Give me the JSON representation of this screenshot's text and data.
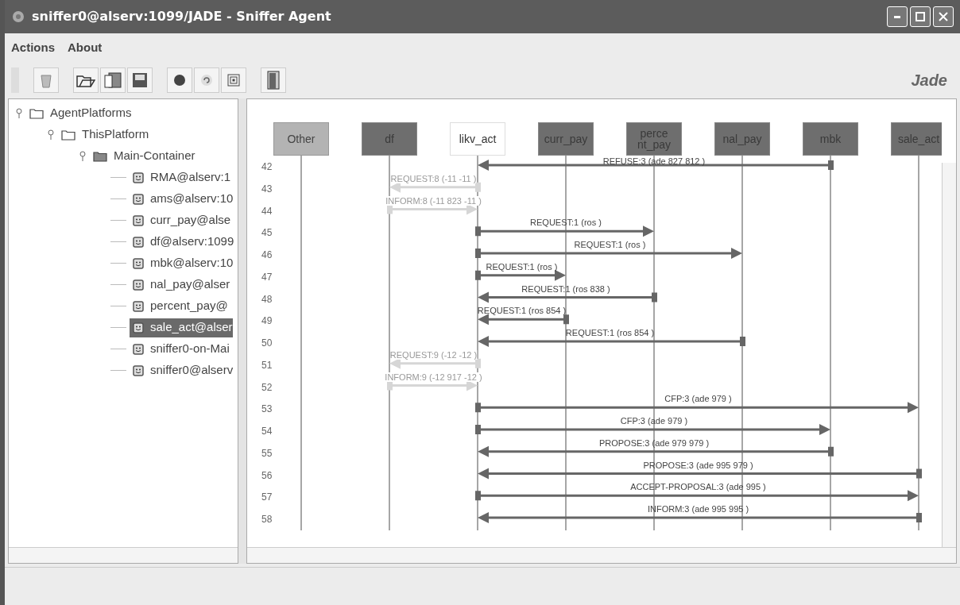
{
  "window": {
    "title": "sniffer0@alserv:1099/JADE - Sniffer Agent"
  },
  "menu": [
    "Actions",
    "About"
  ],
  "logo": "Jade",
  "tree": [
    {
      "label": "AgentPlatforms",
      "kind": "folder",
      "expanded": true,
      "children": [
        {
          "label": "ThisPlatform",
          "kind": "folder",
          "expanded": true,
          "children": [
            {
              "label": "Main-Container",
              "kind": "container",
              "expanded": true,
              "children": [
                {
                  "label": "RMA@alserv:1",
                  "kind": "agent",
                  "selected": false
                },
                {
                  "label": "ams@alserv:10",
                  "kind": "agent",
                  "selected": false
                },
                {
                  "label": "curr_pay@alse",
                  "kind": "agent",
                  "selected": false
                },
                {
                  "label": "df@alserv:1099",
                  "kind": "agent",
                  "selected": false
                },
                {
                  "label": "mbk@alserv:10",
                  "kind": "agent",
                  "selected": false
                },
                {
                  "label": "nal_pay@alser",
                  "kind": "agent",
                  "selected": false
                },
                {
                  "label": "percent_pay@",
                  "kind": "agent",
                  "selected": false
                },
                {
                  "label": "sale_act@alser",
                  "kind": "agent",
                  "selected": true
                },
                {
                  "label": "sniffer0-on-Mai",
                  "kind": "agent",
                  "selected": false
                },
                {
                  "label": "sniffer0@alserv",
                  "kind": "agent",
                  "selected": false
                }
              ]
            }
          ]
        }
      ]
    }
  ],
  "agents": [
    {
      "label": "Other",
      "kind": "other"
    },
    {
      "label": "df",
      "kind": "sniffed"
    },
    {
      "label": "likv_act",
      "kind": "plain"
    },
    {
      "label": "curr_pay",
      "kind": "sniffed"
    },
    {
      "label": "perce nt_pay",
      "kind": "sniffed"
    },
    {
      "label": "nal_pay",
      "kind": "sniffed"
    },
    {
      "label": "mbk",
      "kind": "sniffed"
    },
    {
      "label": "sale_act",
      "kind": "sniffed"
    }
  ],
  "messages": [
    {
      "number": "42",
      "lanes": [
        {
          "kind": "idle"
        },
        {
          "kind": "idle"
        },
        {
          "kind": "target"
        },
        {
          "kind": "idle"
        },
        {
          "kind": "idle"
        },
        {
          "kind": "idle"
        },
        {
          "kind": "source"
        },
        {
          "kind": "idle"
        }
      ],
      "label": "REFUSE:3 (ade 827 812 )",
      "faded": false
    },
    {
      "number": "43",
      "lanes": [
        {
          "kind": "idle"
        },
        {
          "kind": "target"
        },
        {
          "kind": "source"
        },
        {
          "kind": "idle"
        },
        {
          "kind": "idle"
        },
        {
          "kind": "idle"
        },
        {
          "kind": "idle"
        },
        {
          "kind": "idle"
        }
      ],
      "label": "REQUEST:8 (-11 -11 )",
      "faded": true
    },
    {
      "number": "44",
      "lanes": [
        {
          "kind": "idle"
        },
        {
          "kind": "source"
        },
        {
          "kind": "target"
        },
        {
          "kind": "idle"
        },
        {
          "kind": "idle"
        },
        {
          "kind": "idle"
        },
        {
          "kind": "idle"
        },
        {
          "kind": "idle"
        }
      ],
      "label": "INFORM:8 (-11 823 -11 )",
      "faded": true
    },
    {
      "number": "45",
      "lanes": [
        {
          "kind": "idle"
        },
        {
          "kind": "idle"
        },
        {
          "kind": "source"
        },
        {
          "kind": "idle"
        },
        {
          "kind": "target"
        },
        {
          "kind": "idle"
        },
        {
          "kind": "idle"
        },
        {
          "kind": "idle"
        }
      ],
      "label": "REQUEST:1 (ros )",
      "faded": false
    },
    {
      "number": "46",
      "lanes": [
        {
          "kind": "idle"
        },
        {
          "kind": "idle"
        },
        {
          "kind": "source"
        },
        {
          "kind": "idle"
        },
        {
          "kind": "idle"
        },
        {
          "kind": "target"
        },
        {
          "kind": "idle"
        },
        {
          "kind": "idle"
        }
      ],
      "label": "REQUEST:1 (ros )",
      "faded": false
    },
    {
      "number": "47",
      "lanes": [
        {
          "kind": "idle"
        },
        {
          "kind": "idle"
        },
        {
          "kind": "source"
        },
        {
          "kind": "target"
        },
        {
          "kind": "idle"
        },
        {
          "kind": "idle"
        },
        {
          "kind": "idle"
        },
        {
          "kind": "idle"
        }
      ],
      "label": "REQUEST:1 (ros )",
      "faded": false
    },
    {
      "number": "48",
      "lanes": [
        {
          "kind": "idle"
        },
        {
          "kind": "idle"
        },
        {
          "kind": "target"
        },
        {
          "kind": "idle"
        },
        {
          "kind": "source"
        },
        {
          "kind": "idle"
        },
        {
          "kind": "idle"
        },
        {
          "kind": "idle"
        }
      ],
      "label": "REQUEST:1 (ros 838 )",
      "faded": false
    },
    {
      "number": "49",
      "lanes": [
        {
          "kind": "idle"
        },
        {
          "kind": "idle"
        },
        {
          "kind": "target"
        },
        {
          "kind": "source"
        },
        {
          "kind": "idle"
        },
        {
          "kind": "idle"
        },
        {
          "kind": "idle"
        },
        {
          "kind": "idle"
        }
      ],
      "label": "REQUEST:1 (ros 854 )",
      "faded": false
    },
    {
      "number": "50",
      "lanes": [
        {
          "kind": "idle"
        },
        {
          "kind": "idle"
        },
        {
          "kind": "target"
        },
        {
          "kind": "idle"
        },
        {
          "kind": "idle"
        },
        {
          "kind": "source"
        },
        {
          "kind": "idle"
        },
        {
          "kind": "idle"
        }
      ],
      "label": "REQUEST:1 (ros 854 )",
      "faded": false
    },
    {
      "number": "51",
      "lanes": [
        {
          "kind": "idle"
        },
        {
          "kind": "target"
        },
        {
          "kind": "source"
        },
        {
          "kind": "idle"
        },
        {
          "kind": "idle"
        },
        {
          "kind": "idle"
        },
        {
          "kind": "idle"
        },
        {
          "kind": "idle"
        }
      ],
      "label": "REQUEST:9 (-12 -12 )",
      "faded": true
    },
    {
      "number": "52",
      "lanes": [
        {
          "kind": "idle"
        },
        {
          "kind": "source"
        },
        {
          "kind": "target"
        },
        {
          "kind": "idle"
        },
        {
          "kind": "idle"
        },
        {
          "kind": "idle"
        },
        {
          "kind": "idle"
        },
        {
          "kind": "idle"
        }
      ],
      "label": "INFORM:9 (-12 917 -12 )",
      "faded": true
    },
    {
      "number": "53",
      "lanes": [
        {
          "kind": "idle"
        },
        {
          "kind": "idle"
        },
        {
          "kind": "source"
        },
        {
          "kind": "idle"
        },
        {
          "kind": "idle"
        },
        {
          "kind": "idle"
        },
        {
          "kind": "idle"
        },
        {
          "kind": "target"
        }
      ],
      "label": "CFP:3 (ade 979 )",
      "faded": false
    },
    {
      "number": "54",
      "lanes": [
        {
          "kind": "idle"
        },
        {
          "kind": "idle"
        },
        {
          "kind": "source"
        },
        {
          "kind": "idle"
        },
        {
          "kind": "idle"
        },
        {
          "kind": "idle"
        },
        {
          "kind": "target"
        },
        {
          "kind": "idle"
        }
      ],
      "label": "CFP:3 (ade 979 )",
      "faded": false
    },
    {
      "number": "55",
      "lanes": [
        {
          "kind": "idle"
        },
        {
          "kind": "idle"
        },
        {
          "kind": "target"
        },
        {
          "kind": "idle"
        },
        {
          "kind": "idle"
        },
        {
          "kind": "idle"
        },
        {
          "kind": "source"
        },
        {
          "kind": "idle"
        }
      ],
      "label": "PROPOSE:3 (ade 979 979 )",
      "faded": false
    },
    {
      "number": "56",
      "lanes": [
        {
          "kind": "idle"
        },
        {
          "kind": "idle"
        },
        {
          "kind": "target"
        },
        {
          "kind": "idle"
        },
        {
          "kind": "idle"
        },
        {
          "kind": "idle"
        },
        {
          "kind": "idle"
        },
        {
          "kind": "source"
        }
      ],
      "label": "PROPOSE:3 (ade 995 979 )",
      "faded": false
    },
    {
      "number": "57",
      "lanes": [
        {
          "kind": "idle"
        },
        {
          "kind": "idle"
        },
        {
          "kind": "source"
        },
        {
          "kind": "idle"
        },
        {
          "kind": "idle"
        },
        {
          "kind": "idle"
        },
        {
          "kind": "idle"
        },
        {
          "kind": "target"
        }
      ],
      "label": "ACCEPT-PROPOSAL:3 (ade 995 )",
      "faded": false
    },
    {
      "number": "58",
      "lanes": [
        {
          "kind": "idle"
        },
        {
          "kind": "idle"
        },
        {
          "kind": "target"
        },
        {
          "kind": "idle"
        },
        {
          "kind": "idle"
        },
        {
          "kind": "idle"
        },
        {
          "kind": "idle"
        },
        {
          "kind": "source"
        }
      ],
      "label": "INFORM:3 (ade 995 995 )",
      "faded": false
    }
  ]
}
